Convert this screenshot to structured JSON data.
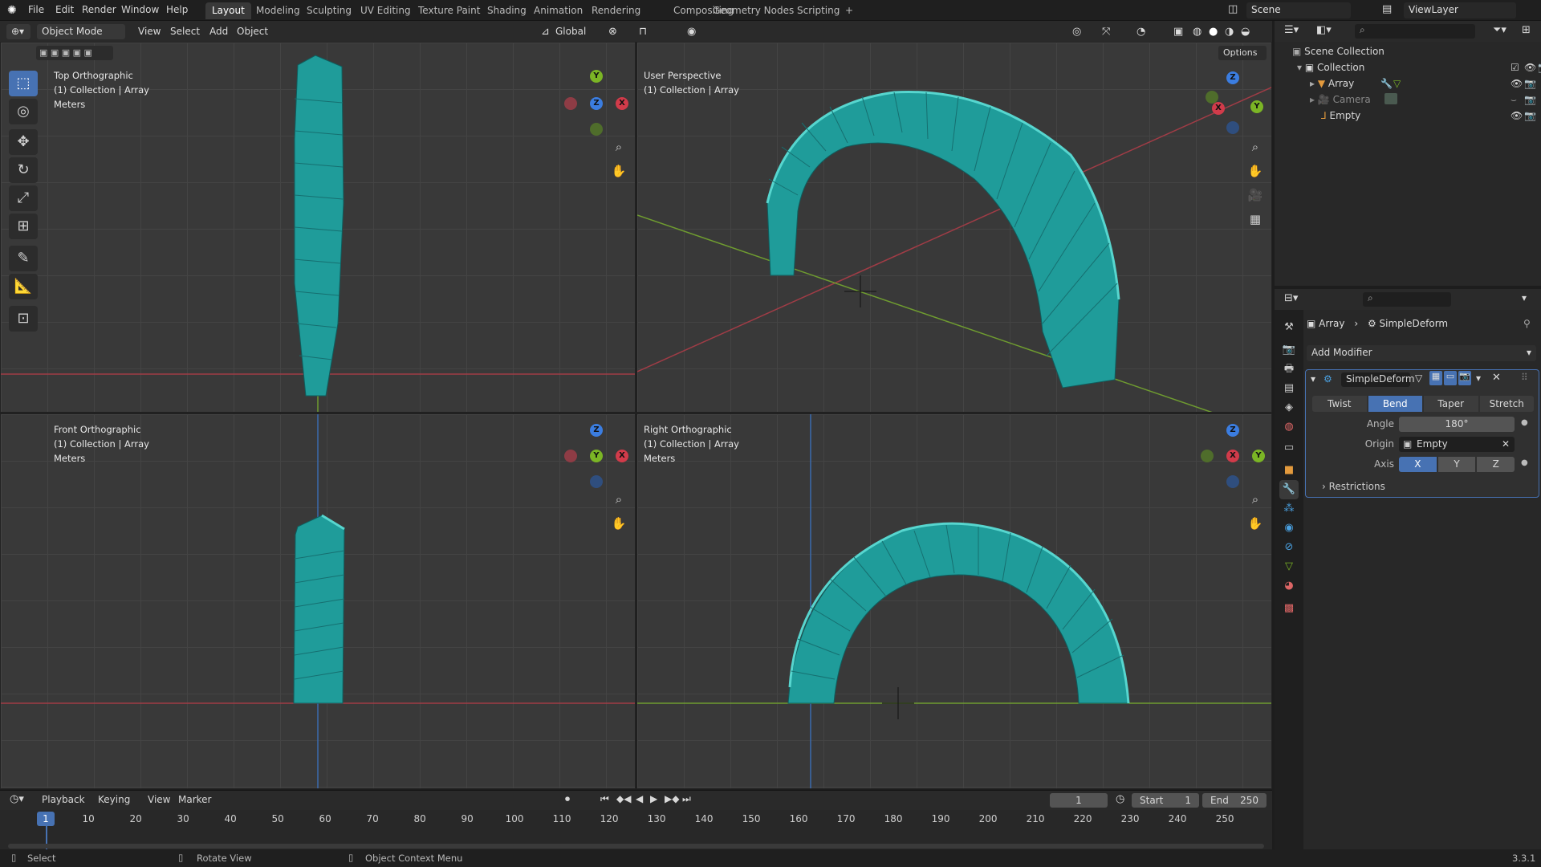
{
  "topbar": {
    "menus": [
      "File",
      "Edit",
      "Render",
      "Window",
      "Help"
    ],
    "workspaces": [
      "Layout",
      "Modeling",
      "Sculpting",
      "UV Editing",
      "Texture Paint",
      "Shading",
      "Animation",
      "Rendering",
      "Compositing",
      "Geometry Nodes",
      "Scripting"
    ],
    "add_workspace": "+",
    "scene": "Scene",
    "view_layer": "ViewLayer"
  },
  "viewport_header": {
    "mode": "Object Mode",
    "menus": [
      "View",
      "Select",
      "Add",
      "Object"
    ],
    "orientation": "Global",
    "options": "Options"
  },
  "viewports": {
    "top": {
      "title": "Top Orthographic",
      "sub": "(1) Collection | Array",
      "units": "Meters"
    },
    "persp": {
      "title": "User Perspective",
      "sub": "(1) Collection | Array"
    },
    "front": {
      "title": "Front Orthographic",
      "sub": "(1) Collection | Array",
      "units": "Meters"
    },
    "right": {
      "title": "Right Orthographic",
      "sub": "(1) Collection | Array",
      "units": "Meters"
    }
  },
  "gizmo": {
    "x": "X",
    "y": "Y",
    "z": "Z"
  },
  "outliner": {
    "root": "Scene Collection",
    "collection": "Collection",
    "items": [
      "Array",
      "Camera",
      "Empty"
    ]
  },
  "properties": {
    "breadcrumb_object": "Array",
    "breadcrumb_modifier": "SimpleDeform",
    "add_modifier": "Add Modifier",
    "modifier_name": "SimpleDeform",
    "deform_modes": [
      "Twist",
      "Bend",
      "Taper",
      "Stretch"
    ],
    "active_mode": "Bend",
    "angle_label": "Angle",
    "angle_value": "180°",
    "origin_label": "Origin",
    "origin_value": "Empty",
    "axis_label": "Axis",
    "axes": [
      "X",
      "Y",
      "Z"
    ],
    "active_axis": "X",
    "restrictions": "Restrictions"
  },
  "timeline": {
    "menus": [
      "Playback",
      "Keying",
      "View",
      "Marker"
    ],
    "current_frame": "1",
    "start_label": "Start",
    "start": "1",
    "end_label": "End",
    "end": "250",
    "ticks": [
      "1",
      "10",
      "20",
      "30",
      "40",
      "50",
      "60",
      "70",
      "80",
      "90",
      "100",
      "110",
      "120",
      "130",
      "140",
      "150",
      "160",
      "170",
      "180",
      "190",
      "200",
      "210",
      "220",
      "230",
      "240",
      "250"
    ]
  },
  "statusbar": {
    "select": "Select",
    "rotate": "Rotate View",
    "context": "Object Context Menu",
    "version": "3.3.1"
  },
  "colors": {
    "accent": "#4772b3",
    "mesh": "#1f9c9a",
    "axis_x": "#d13b4a",
    "axis_y": "#7bb525",
    "axis_z": "#3b7de0"
  }
}
